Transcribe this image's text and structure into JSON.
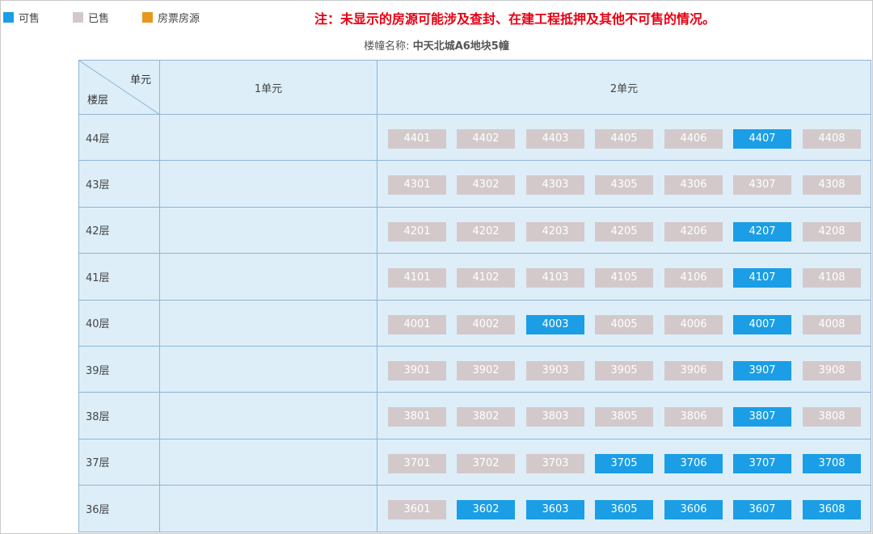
{
  "legend": [
    {
      "label": "可售",
      "color": "#1b9ee5"
    },
    {
      "label": "已售",
      "color": "#d3c9cb"
    },
    {
      "label": "房票房源",
      "color": "#e8961e"
    }
  ],
  "notice": "注：未显示的房源可能涉及查封、在建工程抵押及其他不可售的情况。",
  "building": {
    "label": "楼幢名称:",
    "name": "中天北城A6地块5幢"
  },
  "header": {
    "corner_unit": "单元",
    "corner_floor": "楼层",
    "unit1": "1单元",
    "unit2": "2单元"
  },
  "colors": {
    "available": "#1b9ee5",
    "sold": "#d3c9cb",
    "ticket": "#e8961e",
    "notice": "#e60012",
    "cell_bg": "#ddeef8",
    "border": "#8fb4d8"
  },
  "floors": [
    {
      "label": "44层",
      "rooms": [
        {
          "no": "4401",
          "status": "sold"
        },
        {
          "no": "4402",
          "status": "sold"
        },
        {
          "no": "4403",
          "status": "sold"
        },
        {
          "no": "4405",
          "status": "sold"
        },
        {
          "no": "4406",
          "status": "sold"
        },
        {
          "no": "4407",
          "status": "available"
        },
        {
          "no": "4408",
          "status": "sold"
        }
      ]
    },
    {
      "label": "43层",
      "rooms": [
        {
          "no": "4301",
          "status": "sold"
        },
        {
          "no": "4302",
          "status": "sold"
        },
        {
          "no": "4303",
          "status": "sold"
        },
        {
          "no": "4305",
          "status": "sold"
        },
        {
          "no": "4306",
          "status": "sold"
        },
        {
          "no": "4307",
          "status": "sold"
        },
        {
          "no": "4308",
          "status": "sold"
        }
      ]
    },
    {
      "label": "42层",
      "rooms": [
        {
          "no": "4201",
          "status": "sold"
        },
        {
          "no": "4202",
          "status": "sold"
        },
        {
          "no": "4203",
          "status": "sold"
        },
        {
          "no": "4205",
          "status": "sold"
        },
        {
          "no": "4206",
          "status": "sold"
        },
        {
          "no": "4207",
          "status": "available"
        },
        {
          "no": "4208",
          "status": "sold"
        }
      ]
    },
    {
      "label": "41层",
      "rooms": [
        {
          "no": "4101",
          "status": "sold"
        },
        {
          "no": "4102",
          "status": "sold"
        },
        {
          "no": "4103",
          "status": "sold"
        },
        {
          "no": "4105",
          "status": "sold"
        },
        {
          "no": "4106",
          "status": "sold"
        },
        {
          "no": "4107",
          "status": "available"
        },
        {
          "no": "4108",
          "status": "sold"
        }
      ]
    },
    {
      "label": "40层",
      "rooms": [
        {
          "no": "4001",
          "status": "sold"
        },
        {
          "no": "4002",
          "status": "sold"
        },
        {
          "no": "4003",
          "status": "available"
        },
        {
          "no": "4005",
          "status": "sold"
        },
        {
          "no": "4006",
          "status": "sold"
        },
        {
          "no": "4007",
          "status": "available"
        },
        {
          "no": "4008",
          "status": "sold"
        }
      ]
    },
    {
      "label": "39层",
      "rooms": [
        {
          "no": "3901",
          "status": "sold"
        },
        {
          "no": "3902",
          "status": "sold"
        },
        {
          "no": "3903",
          "status": "sold"
        },
        {
          "no": "3905",
          "status": "sold"
        },
        {
          "no": "3906",
          "status": "sold"
        },
        {
          "no": "3907",
          "status": "available"
        },
        {
          "no": "3908",
          "status": "sold"
        }
      ]
    },
    {
      "label": "38层",
      "rooms": [
        {
          "no": "3801",
          "status": "sold"
        },
        {
          "no": "3802",
          "status": "sold"
        },
        {
          "no": "3803",
          "status": "sold"
        },
        {
          "no": "3805",
          "status": "sold"
        },
        {
          "no": "3806",
          "status": "sold"
        },
        {
          "no": "3807",
          "status": "available"
        },
        {
          "no": "3808",
          "status": "sold"
        }
      ]
    },
    {
      "label": "37层",
      "rooms": [
        {
          "no": "3701",
          "status": "sold"
        },
        {
          "no": "3702",
          "status": "sold"
        },
        {
          "no": "3703",
          "status": "sold"
        },
        {
          "no": "3705",
          "status": "available"
        },
        {
          "no": "3706",
          "status": "available"
        },
        {
          "no": "3707",
          "status": "available"
        },
        {
          "no": "3708",
          "status": "available"
        }
      ]
    },
    {
      "label": "36层",
      "rooms": [
        {
          "no": "3601",
          "status": "sold"
        },
        {
          "no": "3602",
          "status": "available"
        },
        {
          "no": "3603",
          "status": "available"
        },
        {
          "no": "3605",
          "status": "available"
        },
        {
          "no": "3606",
          "status": "available"
        },
        {
          "no": "3607",
          "status": "available"
        },
        {
          "no": "3608",
          "status": "available"
        }
      ]
    }
  ]
}
